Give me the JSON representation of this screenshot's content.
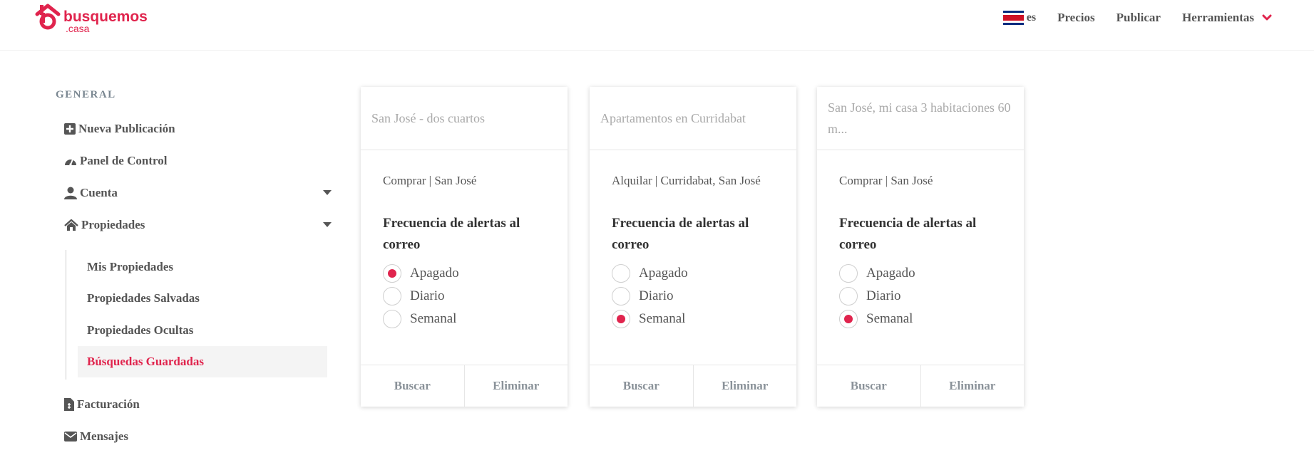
{
  "brand": {
    "name": "busquemos",
    "sub": ".casa",
    "color": "#e0244d"
  },
  "nav": {
    "lang": "es",
    "links": [
      "Precios",
      "Publicar"
    ],
    "tools": "Herramientas"
  },
  "sidebar": {
    "section_title": "GENERAL",
    "items": [
      {
        "label": "Nueva Publicación",
        "icon": "plus-square-icon"
      },
      {
        "label": "Panel de Control",
        "icon": "dashboard-icon"
      },
      {
        "label": "Cuenta",
        "icon": "user-icon"
      },
      {
        "label": "Propiedades",
        "icon": "home-icon"
      },
      {
        "label": "Facturación",
        "icon": "invoice-icon"
      },
      {
        "label": "Mensajes",
        "icon": "envelope-icon"
      }
    ],
    "subitems": [
      {
        "label": "Mis Propiedades"
      },
      {
        "label": "Propiedades Salvadas"
      },
      {
        "label": "Propiedades Ocultas"
      },
      {
        "label": "Búsquedas Guardadas",
        "active": true
      }
    ]
  },
  "alert_frequency_label": "Frecuencia de alertas al correo",
  "radio_options": [
    "Apagado",
    "Diario",
    "Semanal"
  ],
  "actions": {
    "search": "Buscar",
    "delete": "Eliminar"
  },
  "cards": [
    {
      "title": "San José - dos cuartos",
      "meta": "Comprar | San José",
      "selected": "Apagado"
    },
    {
      "title": "Apartamentos en Curridabat",
      "meta": "Alquilar | Curridabat, San José",
      "selected": "Semanal"
    },
    {
      "title": "San José, mi casa 3 habitaciones 60 m...",
      "meta": "Comprar | San José",
      "selected": "Semanal"
    }
  ]
}
